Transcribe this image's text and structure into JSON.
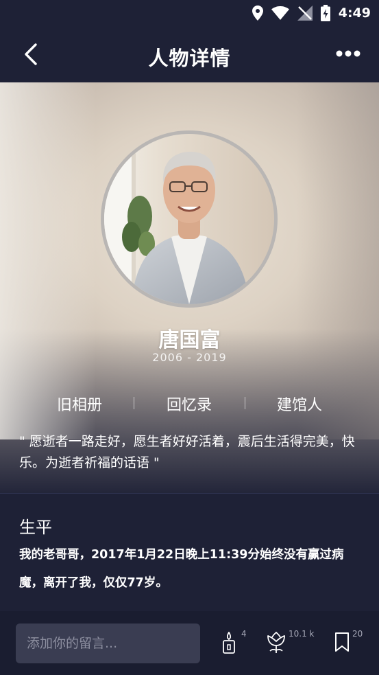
{
  "status_bar": {
    "time": "4:49"
  },
  "header": {
    "title": "人物详情"
  },
  "profile": {
    "name": "唐国富",
    "years": "2006 - 2019"
  },
  "tabs": [
    {
      "label": "旧相册"
    },
    {
      "label": "回忆录"
    },
    {
      "label": "建馆人"
    }
  ],
  "quote": "\" 愿逝者一路走好，愿生者好好活着，震后生活得完美，快乐。为逝者祈福的话语 \"",
  "biography": {
    "title": "生平",
    "text": "我的老哥哥，2017年1月22日晚上11:39分始终没有赢过病魔，离开了我，仅仅77岁。"
  },
  "bottom_bar": {
    "comment_placeholder": "添加你的留言...",
    "candle_count": "4",
    "flower_count": "10.1 k",
    "bookmark_count": "20"
  },
  "colors": {
    "background": "#1e2136",
    "bottom_bar": "#1a1d30",
    "input_bg": "#3a3d52"
  }
}
